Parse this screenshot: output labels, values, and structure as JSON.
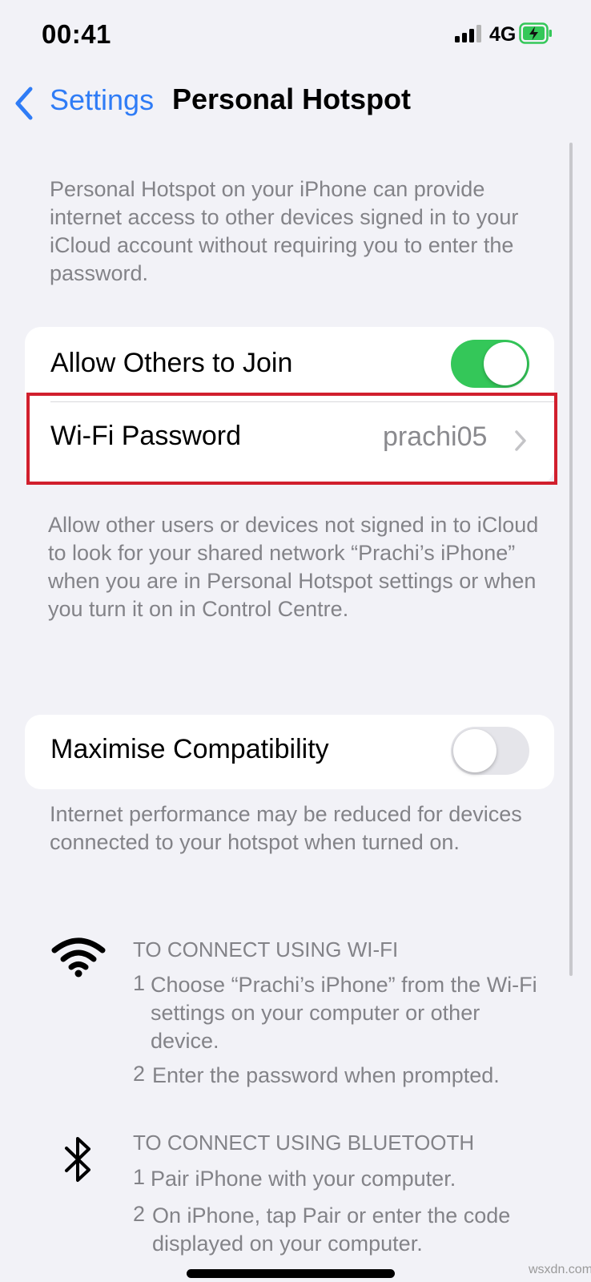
{
  "status_bar": {
    "time": "00:41",
    "network": "4G",
    "icons": [
      "signal-icon",
      "battery-charging-icon"
    ]
  },
  "nav": {
    "back_label": "Settings",
    "title": "Personal Hotspot"
  },
  "intro_text": "Personal Hotspot on your iPhone can provide internet access to other devices signed in to your iCloud account without requiring you to enter the password.",
  "group1": {
    "allow_label": "Allow Others to Join",
    "allow_on": true,
    "wifi_label": "Wi-Fi Password",
    "wifi_value": "prachi05",
    "footer": "Allow other users or devices not signed in to iCloud to look for your shared network “Prachi’s iPhone” when you are in Personal Hotspot settings or when you turn it on in Control Centre."
  },
  "group2": {
    "max_label": "Maximise Compatibility",
    "max_on": false,
    "footer": "Internet performance may be reduced for devices connected to your hotspot when turned on."
  },
  "wifi_instructions": {
    "heading": "TO CONNECT USING WI-FI",
    "step1_num": "1",
    "step1": "Choose “Prachi’s iPhone” from the Wi-Fi settings on your computer or other device.",
    "step2_num": "2",
    "step2": "Enter the password when prompted."
  },
  "bt_instructions": {
    "heading": "TO CONNECT USING BLUETOOTH",
    "step1_num": "1",
    "step1": "Pair iPhone with your computer.",
    "step2_num": "2",
    "step2": "On iPhone, tap Pair or enter the code displayed on your computer."
  },
  "watermark": "wsxdn.com",
  "colors": {
    "accent": "#2f7cf6",
    "toggle_on": "#34c759",
    "highlight": "#d11f2d",
    "background": "#f2f2f7"
  }
}
